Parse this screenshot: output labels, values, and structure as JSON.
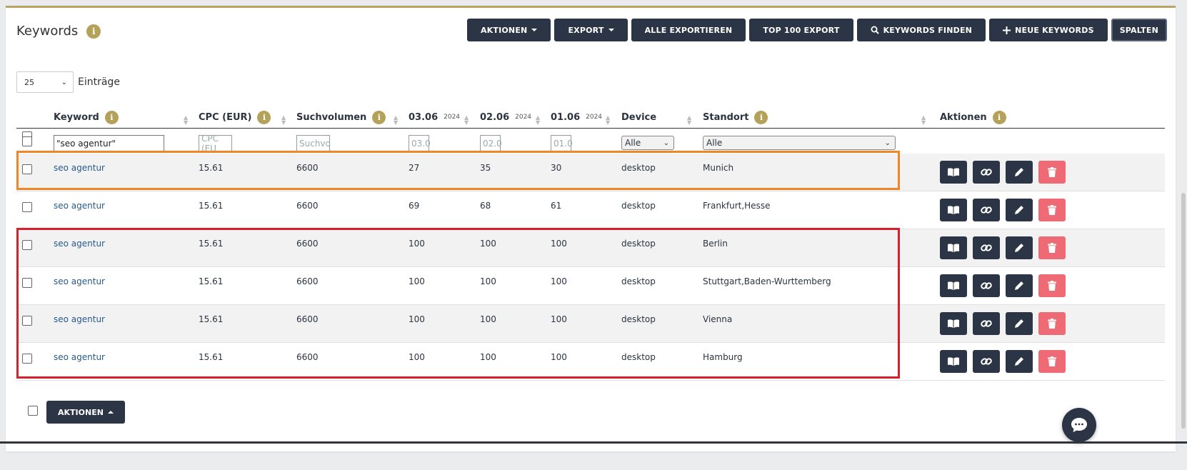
{
  "page": {
    "title": "Keywords"
  },
  "toolbar": {
    "aktionen": "AKTIONEN",
    "export": "EXPORT",
    "alle_exportieren": "ALLE EXPORTIEREN",
    "top100": "TOP 100 EXPORT",
    "keywords_finden": "KEYWORDS FINDEN",
    "neue_keywords": "NEUE KEYWORDS",
    "spalten": "SPALTEN"
  },
  "entries": {
    "value": "25",
    "label": "Einträge"
  },
  "columns": {
    "keyword": "Keyword",
    "cpc": "CPC (EUR)",
    "volume": "Suchvolumen",
    "d1": "03.06",
    "d1_year": "2024",
    "d2": "02.06",
    "d2_year": "2024",
    "d3": "01.06",
    "d3_year": "2024",
    "device": "Device",
    "location": "Standort",
    "actions": "Aktionen"
  },
  "filters": {
    "keyword_value": "\"seo agentur\"",
    "cpc_placeholder": "CPC (EU",
    "volume_placeholder": "Suchvo",
    "d1_placeholder": "03.0",
    "d2_placeholder": "02.0",
    "d3_placeholder": "01.0",
    "device_value": "Alle",
    "location_value": "Alle"
  },
  "rows": [
    {
      "keyword": "seo agentur",
      "cpc": "15.61",
      "volume": "6600",
      "d1": "27",
      "d2": "35",
      "d3": "30",
      "device": "desktop",
      "location": "Munich"
    },
    {
      "keyword": "seo agentur",
      "cpc": "15.61",
      "volume": "6600",
      "d1": "69",
      "d2": "68",
      "d3": "61",
      "device": "desktop",
      "location": "Frankfurt,Hesse"
    },
    {
      "keyword": "seo agentur",
      "cpc": "15.61",
      "volume": "6600",
      "d1": "100",
      "d2": "100",
      "d3": "100",
      "device": "desktop",
      "location": "Berlin"
    },
    {
      "keyword": "seo agentur",
      "cpc": "15.61",
      "volume": "6600",
      "d1": "100",
      "d2": "100",
      "d3": "100",
      "device": "desktop",
      "location": "Stuttgart,Baden-Wurttemberg"
    },
    {
      "keyword": "seo agentur",
      "cpc": "15.61",
      "volume": "6600",
      "d1": "100",
      "d2": "100",
      "d3": "100",
      "device": "desktop",
      "location": "Vienna"
    },
    {
      "keyword": "seo agentur",
      "cpc": "15.61",
      "volume": "6600",
      "d1": "100",
      "d2": "100",
      "d3": "100",
      "device": "desktop",
      "location": "Hamburg"
    }
  ],
  "footer": {
    "aktionen": "AKTIONEN"
  },
  "colors": {
    "accent_gold": "#b4a15a",
    "button_dark": "#2b3545",
    "delete_red": "#ee6b75",
    "highlight_orange": "#f08628",
    "highlight_red": "#d7202a",
    "link_blue": "#275a8a"
  }
}
